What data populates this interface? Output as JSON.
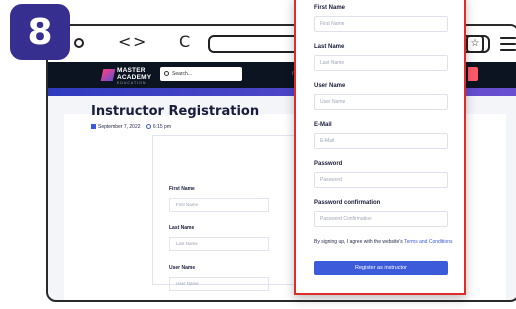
{
  "step_badge": "8",
  "browser": {
    "nav_back": "<",
    "nav_forward": ">",
    "reload": "C",
    "star": "☆"
  },
  "site": {
    "logo_line1": "MASTER",
    "logo_line2": "ACADEMY",
    "logo_sub": "EDUCATION",
    "search_placeholder": "Search..."
  },
  "page": {
    "title": "Instructor Registration",
    "date": "September 7, 2022",
    "time": "6:15 pm",
    "form": {
      "fields": [
        {
          "label": "First Name",
          "placeholder": "First Name"
        },
        {
          "label": "Last Name",
          "placeholder": "Last Name"
        },
        {
          "label": "User Name",
          "placeholder": "User Name"
        }
      ]
    }
  },
  "modal": {
    "fields": [
      {
        "label": "First Name",
        "placeholder": "First Name"
      },
      {
        "label": "Last Name",
        "placeholder": "Last Name"
      },
      {
        "label": "User Name",
        "placeholder": "User Name"
      },
      {
        "label": "E-Mail",
        "placeholder": "E-Mail"
      },
      {
        "label": "Password",
        "placeholder": "Password"
      },
      {
        "label": "Password confirmation",
        "placeholder": "Password Confirmation"
      }
    ],
    "consent_text": "By signing up, I agree with the website's",
    "consent_link": "Terms and Conditions",
    "submit_label": "Register as instructor"
  },
  "colors": {
    "badge": "#372f8f",
    "nav_bg": "#0c1321",
    "accent": "#3b5bdb",
    "highlight_border": "#e02b2b"
  }
}
